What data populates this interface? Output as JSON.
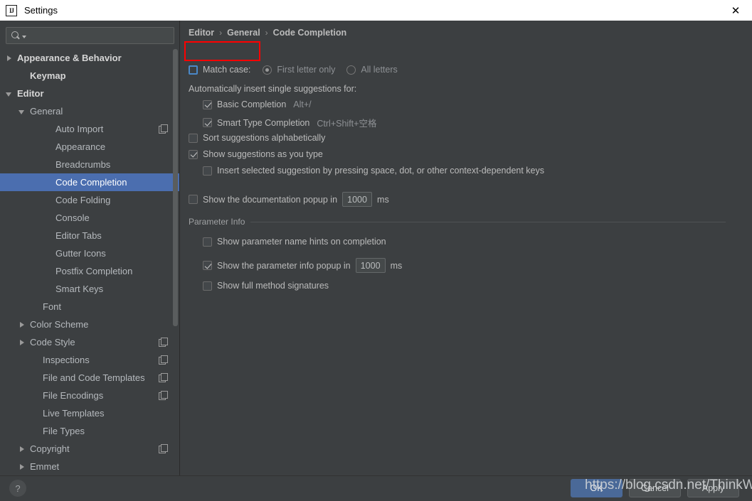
{
  "window": {
    "title": "Settings",
    "app_icon": "intellij-idea-logo-icon",
    "close_icon": "✕"
  },
  "sidebar": {
    "search": {
      "value": "",
      "placeholder": "",
      "icon": "search-icon"
    },
    "items": [
      {
        "label": "Appearance & Behavior",
        "indent": 6,
        "arrow": "collapsed",
        "bold": true,
        "selected": false,
        "copy": false
      },
      {
        "label": "Keymap",
        "indent": 24,
        "arrow": "none",
        "bold": true,
        "selected": false,
        "copy": false
      },
      {
        "label": "Editor",
        "indent": 6,
        "arrow": "expanded",
        "bold": true,
        "selected": false,
        "copy": false
      },
      {
        "label": "General",
        "indent": 24,
        "arrow": "expanded",
        "bold": false,
        "selected": false,
        "copy": false
      },
      {
        "label": "Auto Import",
        "indent": 60,
        "arrow": "none",
        "bold": false,
        "selected": false,
        "copy": true
      },
      {
        "label": "Appearance",
        "indent": 60,
        "arrow": "none",
        "bold": false,
        "selected": false,
        "copy": false
      },
      {
        "label": "Breadcrumbs",
        "indent": 60,
        "arrow": "none",
        "bold": false,
        "selected": false,
        "copy": false
      },
      {
        "label": "Code Completion",
        "indent": 60,
        "arrow": "none",
        "bold": false,
        "selected": true,
        "copy": false
      },
      {
        "label": "Code Folding",
        "indent": 60,
        "arrow": "none",
        "bold": false,
        "selected": false,
        "copy": false
      },
      {
        "label": "Console",
        "indent": 60,
        "arrow": "none",
        "bold": false,
        "selected": false,
        "copy": false
      },
      {
        "label": "Editor Tabs",
        "indent": 60,
        "arrow": "none",
        "bold": false,
        "selected": false,
        "copy": false
      },
      {
        "label": "Gutter Icons",
        "indent": 60,
        "arrow": "none",
        "bold": false,
        "selected": false,
        "copy": false
      },
      {
        "label": "Postfix Completion",
        "indent": 60,
        "arrow": "none",
        "bold": false,
        "selected": false,
        "copy": false
      },
      {
        "label": "Smart Keys",
        "indent": 60,
        "arrow": "none",
        "bold": false,
        "selected": false,
        "copy": false
      },
      {
        "label": "Font",
        "indent": 42,
        "arrow": "none",
        "bold": false,
        "selected": false,
        "copy": false
      },
      {
        "label": "Color Scheme",
        "indent": 24,
        "arrow": "collapsed",
        "bold": false,
        "selected": false,
        "copy": false
      },
      {
        "label": "Code Style",
        "indent": 24,
        "arrow": "collapsed",
        "bold": false,
        "selected": false,
        "copy": true
      },
      {
        "label": "Inspections",
        "indent": 42,
        "arrow": "none",
        "bold": false,
        "selected": false,
        "copy": true
      },
      {
        "label": "File and Code Templates",
        "indent": 42,
        "arrow": "none",
        "bold": false,
        "selected": false,
        "copy": true
      },
      {
        "label": "File Encodings",
        "indent": 42,
        "arrow": "none",
        "bold": false,
        "selected": false,
        "copy": true
      },
      {
        "label": "Live Templates",
        "indent": 42,
        "arrow": "none",
        "bold": false,
        "selected": false,
        "copy": false
      },
      {
        "label": "File Types",
        "indent": 42,
        "arrow": "none",
        "bold": false,
        "selected": false,
        "copy": false
      },
      {
        "label": "Copyright",
        "indent": 24,
        "arrow": "collapsed",
        "bold": false,
        "selected": false,
        "copy": true
      },
      {
        "label": "Emmet",
        "indent": 24,
        "arrow": "collapsed",
        "bold": false,
        "selected": false,
        "copy": false
      }
    ]
  },
  "main": {
    "breadcrumb": [
      "Editor",
      "General",
      "Code Completion"
    ],
    "breadcrumb_separator": "›",
    "match_case": {
      "label": "Match case:",
      "checked": false,
      "focused": true,
      "options": [
        {
          "label": "First letter only",
          "selected": true
        },
        {
          "label": "All letters",
          "selected": false
        }
      ]
    },
    "auto_insert_label": "Automatically insert single suggestions for:",
    "auto_insert_items": [
      {
        "label": "Basic Completion",
        "checked": true,
        "shortcut": "Alt+/"
      },
      {
        "label": "Smart Type Completion",
        "checked": true,
        "shortcut": "Ctrl+Shift+空格"
      }
    ],
    "options": [
      {
        "label": "Sort suggestions alphabetically",
        "checked": false
      },
      {
        "label": "Show suggestions as you type",
        "checked": true
      },
      {
        "label": "Insert selected suggestion by pressing space, dot, or other context-dependent keys",
        "checked": false
      }
    ],
    "doc_popup": {
      "label_before": "Show the documentation popup in",
      "value": "1000",
      "label_after": "ms",
      "checked": false
    },
    "parameter_info": {
      "group_label": "Parameter Info",
      "hints": {
        "label": "Show parameter name hints on completion",
        "checked": false
      },
      "popup": {
        "label_before": "Show the parameter info popup in",
        "value": "1000",
        "label_after": "ms",
        "checked": true
      },
      "signatures": {
        "label": "Show full method signatures",
        "checked": false
      }
    }
  },
  "bottom": {
    "help_label": "?",
    "ok_label": "OK",
    "cancel_label": "Cancel",
    "apply_label": "Apply"
  },
  "watermark": {
    "text": "https://blog.csdn.net/ThinkWon"
  },
  "colors": {
    "accent": "#4b6eaf",
    "primary_button": "#4a6998",
    "annotation": "#ff0000",
    "panel_bg": "#3c3f41",
    "titlebar_bg": "#ffffff"
  }
}
